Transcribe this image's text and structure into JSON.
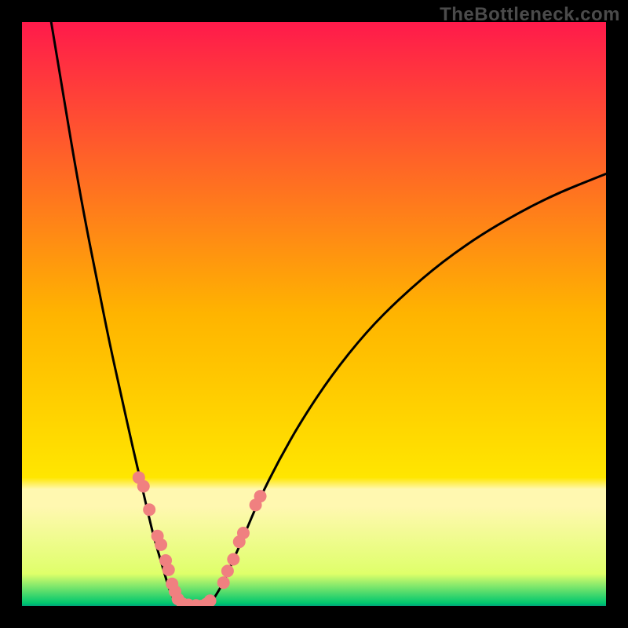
{
  "watermark": "TheBottleneck.com",
  "chart_data": {
    "type": "line",
    "title": "",
    "xlabel": "",
    "ylabel": "",
    "xlim": [
      0,
      100
    ],
    "ylim": [
      0,
      100
    ],
    "gradient_stops": [
      {
        "offset": 0,
        "color": "#ff1a4b"
      },
      {
        "offset": 0.5,
        "color": "#ffb400"
      },
      {
        "offset": 0.78,
        "color": "#ffe600"
      },
      {
        "offset": 0.8,
        "color": "#fff8b0"
      },
      {
        "offset": 0.83,
        "color": "#fff8b0"
      },
      {
        "offset": 0.945,
        "color": "#dfff6a"
      },
      {
        "offset": 0.995,
        "color": "#00c76e"
      },
      {
        "offset": 1.0,
        "color": "#00a47a"
      }
    ],
    "series": [
      {
        "name": "left-curve",
        "x": [
          5,
          7,
          9,
          11,
          13,
          15,
          17,
          19,
          21,
          22.5,
          24,
          25,
          25.8,
          26.5,
          27
        ],
        "y": [
          100,
          88,
          76,
          65,
          55,
          45,
          36,
          27,
          18.5,
          12,
          7,
          3.5,
          1.5,
          0.5,
          0
        ]
      },
      {
        "name": "valley-floor",
        "x": [
          27,
          28,
          29,
          30,
          31,
          32
        ],
        "y": [
          0,
          0,
          0,
          0,
          0,
          0
        ]
      },
      {
        "name": "right-curve",
        "x": [
          32,
          33,
          34.5,
          36,
          38,
          40.5,
          44,
          48,
          53,
          59,
          65,
          72,
          80,
          90,
          100
        ],
        "y": [
          0,
          1.5,
          4,
          7.5,
          12,
          18,
          25,
          32,
          39.5,
          47,
          53,
          59,
          64.5,
          70,
          74
        ]
      }
    ],
    "markers": {
      "name": "datapoints",
      "color": "#f08080",
      "radius_px": 8,
      "points": [
        {
          "x": 20.0,
          "y": 22.0
        },
        {
          "x": 20.8,
          "y": 20.5
        },
        {
          "x": 21.8,
          "y": 16.5
        },
        {
          "x": 23.2,
          "y": 12.0
        },
        {
          "x": 23.8,
          "y": 10.5
        },
        {
          "x": 24.6,
          "y": 7.8
        },
        {
          "x": 25.1,
          "y": 6.2
        },
        {
          "x": 25.7,
          "y": 3.8
        },
        {
          "x": 26.2,
          "y": 2.5
        },
        {
          "x": 26.7,
          "y": 1.2
        },
        {
          "x": 27.5,
          "y": 0.4
        },
        {
          "x": 28.5,
          "y": 0.2
        },
        {
          "x": 29.8,
          "y": 0.1
        },
        {
          "x": 30.7,
          "y": 0.0
        },
        {
          "x": 31.5,
          "y": 0.3
        },
        {
          "x": 32.2,
          "y": 0.9
        },
        {
          "x": 34.5,
          "y": 4.0
        },
        {
          "x": 35.2,
          "y": 6.0
        },
        {
          "x": 36.2,
          "y": 8.0
        },
        {
          "x": 37.2,
          "y": 11.0
        },
        {
          "x": 37.9,
          "y": 12.5
        },
        {
          "x": 40.0,
          "y": 17.3
        },
        {
          "x": 40.8,
          "y": 18.8
        }
      ]
    }
  }
}
